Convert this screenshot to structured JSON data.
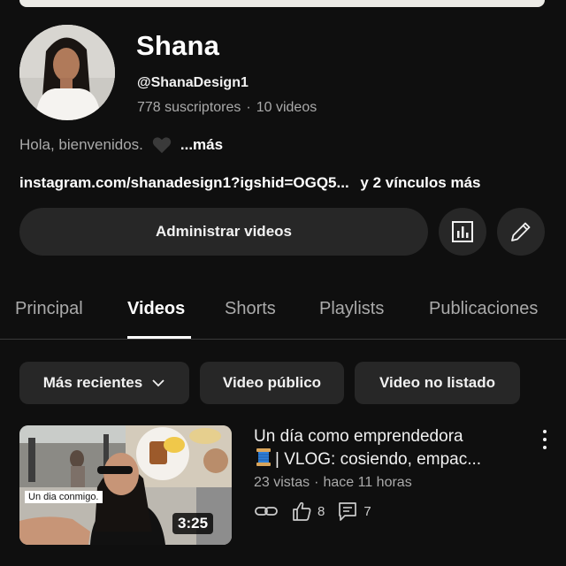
{
  "channel": {
    "name": "Shana",
    "handle": "@ShanaDesign1",
    "subscribers": "778 suscriptores",
    "separator": "·",
    "videos": "10 videos",
    "description": "Hola, bienvenidos.",
    "more_label": "...más",
    "link_text": "instagram.com/shanadesign1?igshid=OGQ5...",
    "extra_links": "y 2 vínculos más"
  },
  "actions": {
    "manage_label": "Administrar videos",
    "stats_icon": "analytics-icon",
    "edit_icon": "pencil-icon"
  },
  "tabs": [
    {
      "label": "Principal",
      "active": false
    },
    {
      "label": "Videos",
      "active": true
    },
    {
      "label": "Shorts",
      "active": false
    },
    {
      "label": "Playlists",
      "active": false
    },
    {
      "label": "Publicaciones",
      "active": false
    }
  ],
  "filters": {
    "sort_label": "Más recientes",
    "public_label": "Video público",
    "unlisted_label": "Video no listado"
  },
  "video": {
    "title_line1": "Un día como emprendedora",
    "title_line2": "| VLOG: cosiendo, empac...",
    "views": "23 vistas",
    "separator": "·",
    "age": "hace 11 horas",
    "duration": "3:25",
    "thumbnail_caption": "Un dia conmigo.",
    "likes": "8",
    "comments": "7"
  },
  "colors": {
    "background": "#0f0f0f",
    "surface": "#272727",
    "text_primary": "#f1f1f1",
    "text_secondary": "#aaaaaa"
  }
}
